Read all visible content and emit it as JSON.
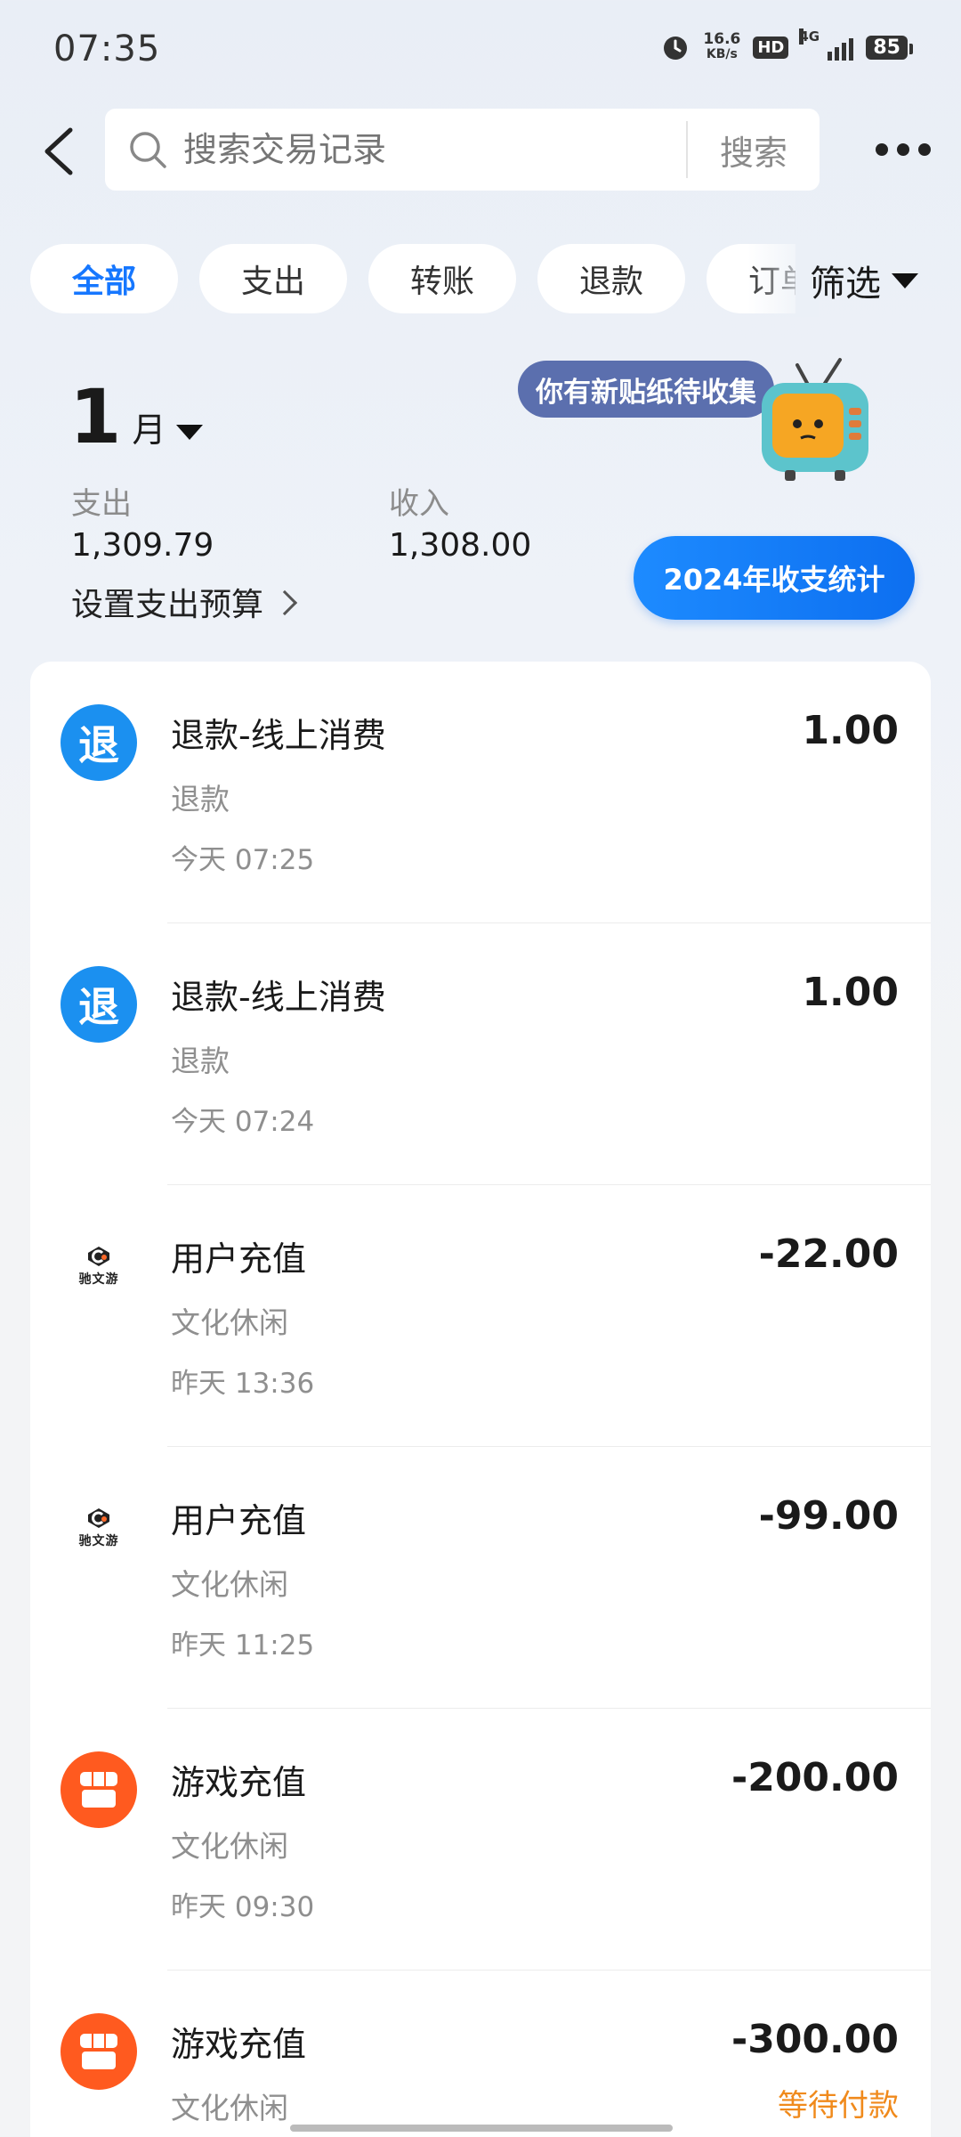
{
  "status_bar": {
    "time": "07:35",
    "net_speed_value": "16.6",
    "net_speed_unit": "KB/s",
    "hd_label": "HD",
    "network_label": "4G",
    "battery": "85",
    "icons": [
      "alarm-icon",
      "signal-icon",
      "battery-icon"
    ]
  },
  "header": {
    "search_placeholder": "搜索交易记录",
    "search_button": "搜索",
    "icons": [
      "back-icon",
      "search-icon",
      "more-icon"
    ]
  },
  "filters": {
    "chips": [
      "全部",
      "支出",
      "转账",
      "退款",
      "订单"
    ],
    "active_index": 0,
    "filter_label": "筛选"
  },
  "summary": {
    "month_number": "1",
    "month_unit": "月",
    "expense_label": "支出",
    "expense_value": "1,309.79",
    "income_label": "收入",
    "income_value": "1,308.00",
    "budget_link": "设置支出预算",
    "sticker_text": "你有新贴纸待收集",
    "year_stats_button": "2024年收支统计"
  },
  "transactions": [
    {
      "icon_type": "refund",
      "icon_text": "退",
      "title": "退款-线上消费",
      "category": "退款",
      "time": "今天 07:25",
      "amount": "1.00",
      "status": ""
    },
    {
      "icon_type": "refund",
      "icon_text": "退",
      "title": "退款-线上消费",
      "category": "退款",
      "time": "今天 07:24",
      "amount": "1.00",
      "status": ""
    },
    {
      "icon_type": "logo",
      "icon_text": "驰文游",
      "title": "用户充值",
      "category": "文化休闲",
      "time": "昨天 13:36",
      "amount": "-22.00",
      "status": ""
    },
    {
      "icon_type": "logo",
      "icon_text": "驰文游",
      "title": "用户充值",
      "category": "文化休闲",
      "time": "昨天 11:25",
      "amount": "-99.00",
      "status": ""
    },
    {
      "icon_type": "store",
      "icon_text": "",
      "title": "游戏充值",
      "category": "文化休闲",
      "time": "昨天 09:30",
      "amount": "-200.00",
      "status": ""
    },
    {
      "icon_type": "store",
      "icon_text": "",
      "title": "游戏充值",
      "category": "文化休闲",
      "time": "",
      "amount": "-300.00",
      "status": "等待付款"
    }
  ],
  "colors": {
    "accent_blue": "#1677ff",
    "refund_icon_bg": "#1b90f0",
    "store_icon_bg": "#ff5a1f",
    "pending_status": "#f08a1c",
    "sticker_bubble": "#5b6fae"
  }
}
